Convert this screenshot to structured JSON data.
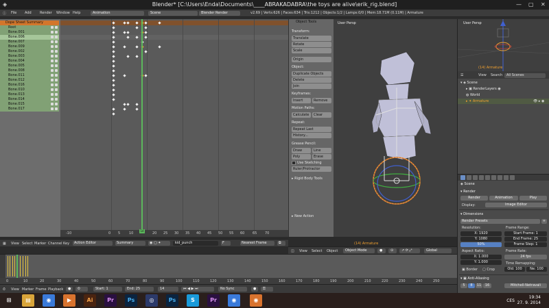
{
  "window": {
    "title": "Blender* [C:\\Users\\Enda\\Documents\\____ABRAKADABRA\\the toys are alive\\erik_rig.blend]"
  },
  "infobar": {
    "menus": [
      "File",
      "Add",
      "Render",
      "Window",
      "Help"
    ],
    "screen": "Animation",
    "scene": "Scene",
    "engine": "Blender Render",
    "stats": "v2.69 | Verts:626 | Faces:634 | Tris:1212 | Objects:1/2 | Lamps:0/0 | Mem:18.71M (0.11M) | Armature"
  },
  "dopesheet": {
    "channels": [
      "Dope Sheet Summary",
      "Root",
      "Bone.001",
      "Bone.006",
      "Bone.007",
      "Bone.009",
      "Bone.002",
      "Bone.003",
      "Bone.004",
      "Bone.005",
      "Bone.008",
      "Bone.011",
      "Bone.012",
      "Bone.016",
      "Bone.010",
      "Bone.013",
      "Bone.014",
      "Bone.015",
      "Bone.017"
    ],
    "ruler": [
      "-10",
      "0",
      "5",
      "10",
      "15",
      "20",
      "25",
      "30",
      "35",
      "40",
      "45",
      "50",
      "55",
      "60",
      "65",
      "70"
    ],
    "current_frame": "14",
    "header": {
      "menus": [
        "View",
        "Select",
        "Marker",
        "Channel",
        "Key"
      ],
      "mode": "Action Editor",
      "summary": "Summary",
      "action": "kid_punch",
      "snap": "Nearest Frame"
    }
  },
  "toolshelf": {
    "header": "Object Tools",
    "transform_label": "Transform:",
    "translate": "Translate",
    "rotate": "Rotate",
    "scale": "Scale",
    "origin": "Origin",
    "object_label": "Object:",
    "duplicate": "Duplicate Objects",
    "delete": "Delete",
    "join": "Join",
    "keyframes_label": "Keyframes:",
    "insert": "Insert",
    "remove": "Remove",
    "motion_label": "Motion Paths:",
    "calculate": "Calculate",
    "clear": "Clear",
    "repeat_label": "Repeat:",
    "repeat_last": "Repeat Last",
    "history": "History...",
    "grease_label": "Grease Pencil:",
    "draw": "Draw",
    "line": "Line",
    "poly": "Poly",
    "erase": "Erase",
    "use_sketching": "Use Sketching Sessio",
    "ruler": "Ruler/Protractor",
    "rigid": "Rigid Body Tools",
    "new_action": "New Action"
  },
  "viewport": {
    "label": "User Persp",
    "object_label": "(14) Armature",
    "header": {
      "menus": [
        "View",
        "Select",
        "Object"
      ],
      "mode": "Object Mode",
      "pivot": "Global"
    }
  },
  "rview": {
    "label": "User Persp",
    "object_label": "(14) Armature"
  },
  "outliner": {
    "menus": [
      "View",
      "Search"
    ],
    "filter": "All Scenes",
    "items": [
      "Scene",
      "RenderLayers",
      "World",
      "Armature"
    ]
  },
  "properties": {
    "scene_label": "Scene",
    "render_label": "Render",
    "render_btn": "Render",
    "animation_btn": "Animation",
    "play_btn": "Play",
    "display_label": "Display:",
    "display_value": "Image Editor",
    "dimensions_label": "Dimensions",
    "presets": "Render Presets",
    "resolution_label": "Resolution:",
    "res_x": "X: 1920",
    "res_y": "Y: 1080",
    "res_pct": "50%",
    "frame_range_label": "Frame Range:",
    "start_frame": "Start Frame: 1",
    "end_frame": "End Frame: 25",
    "frame_step": "Frame Step: 1",
    "aspect_label": "Aspect Ratio:",
    "asp_x": "X: 1.000",
    "asp_y": "Y: 1.000",
    "frame_rate_label": "Frame Rate:",
    "fps": "24 fps",
    "remap_label": "Time Remapping:",
    "old": "Old: 100",
    "new": "Ne: 100",
    "border": "Border",
    "crop": "Crop",
    "anti_aliasing": "Anti-Aliasing",
    "aa_samples": [
      "5",
      "8",
      "11",
      "16"
    ],
    "aa_filter": "Mitchell-Netravali"
  },
  "timeline": {
    "ruler": [
      "0",
      "10",
      "20",
      "30",
      "40",
      "50",
      "60",
      "70",
      "80",
      "90",
      "100",
      "110",
      "120",
      "130",
      "140",
      "150",
      "160",
      "170",
      "180",
      "190",
      "200",
      "210",
      "220",
      "230",
      "240",
      "250"
    ],
    "header": {
      "menus": [
        "View",
        "Marker",
        "Frame",
        "Playback"
      ],
      "start": "Start: 1",
      "end": "End: 25",
      "current": "14",
      "sync": "No Sync"
    }
  },
  "taskbar": {
    "apps": [
      "windows",
      "files",
      "chrome",
      "media",
      "illustrator",
      "premiere",
      "photoshop",
      "cinema4d",
      "photoshop2",
      "skype",
      "premiere2",
      "chrome2",
      "blender"
    ],
    "lang": "CES",
    "time": "19:34",
    "date": "27. 9. 2014"
  }
}
